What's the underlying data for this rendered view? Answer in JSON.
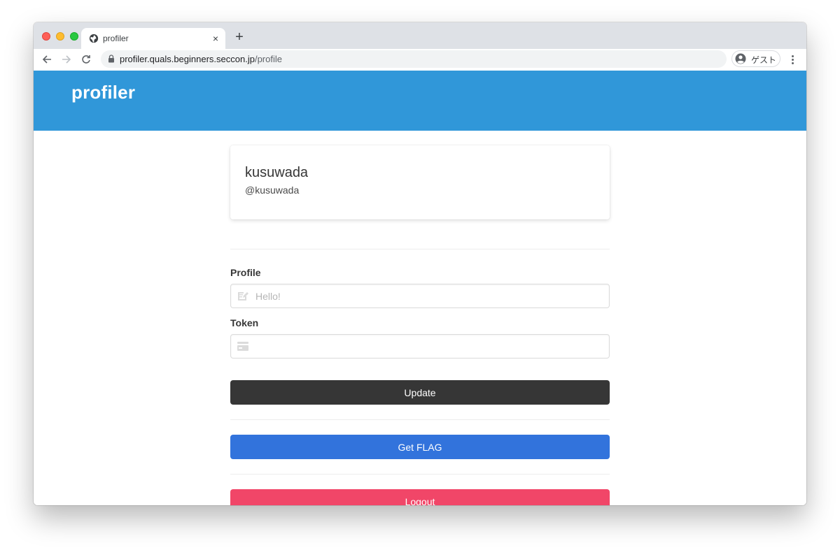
{
  "browser": {
    "tab": {
      "title": "profiler",
      "close_glyph": "×"
    },
    "new_tab_glyph": "+",
    "url": {
      "host": "profiler.quals.beginners.seccon.jp",
      "path": "/profile"
    },
    "profile": {
      "label": "ゲスト"
    },
    "icons": {
      "tab_favicon": "globe-icon",
      "back": "arrow-left-icon",
      "forward": "arrow-right-icon",
      "reload": "reload-icon",
      "lock": "lock-icon",
      "avatar": "person-circle-icon",
      "menu": "kebab-menu-icon"
    }
  },
  "app": {
    "title": "profiler",
    "header_color": "#3097d9"
  },
  "profile_card": {
    "name": "kusuwada",
    "handle": "@kusuwada"
  },
  "form": {
    "profile": {
      "label": "Profile",
      "value": "",
      "placeholder": "Hello!",
      "icon": "pen-to-square-icon"
    },
    "token": {
      "label": "Token",
      "value": "",
      "placeholder": "",
      "icon": "id-card-icon"
    }
  },
  "buttons": {
    "update": {
      "label": "Update",
      "color": "#363636"
    },
    "get_flag": {
      "label": "Get FLAG",
      "color": "#3273dc"
    },
    "logout": {
      "label": "Logout",
      "color": "#f14668"
    }
  }
}
